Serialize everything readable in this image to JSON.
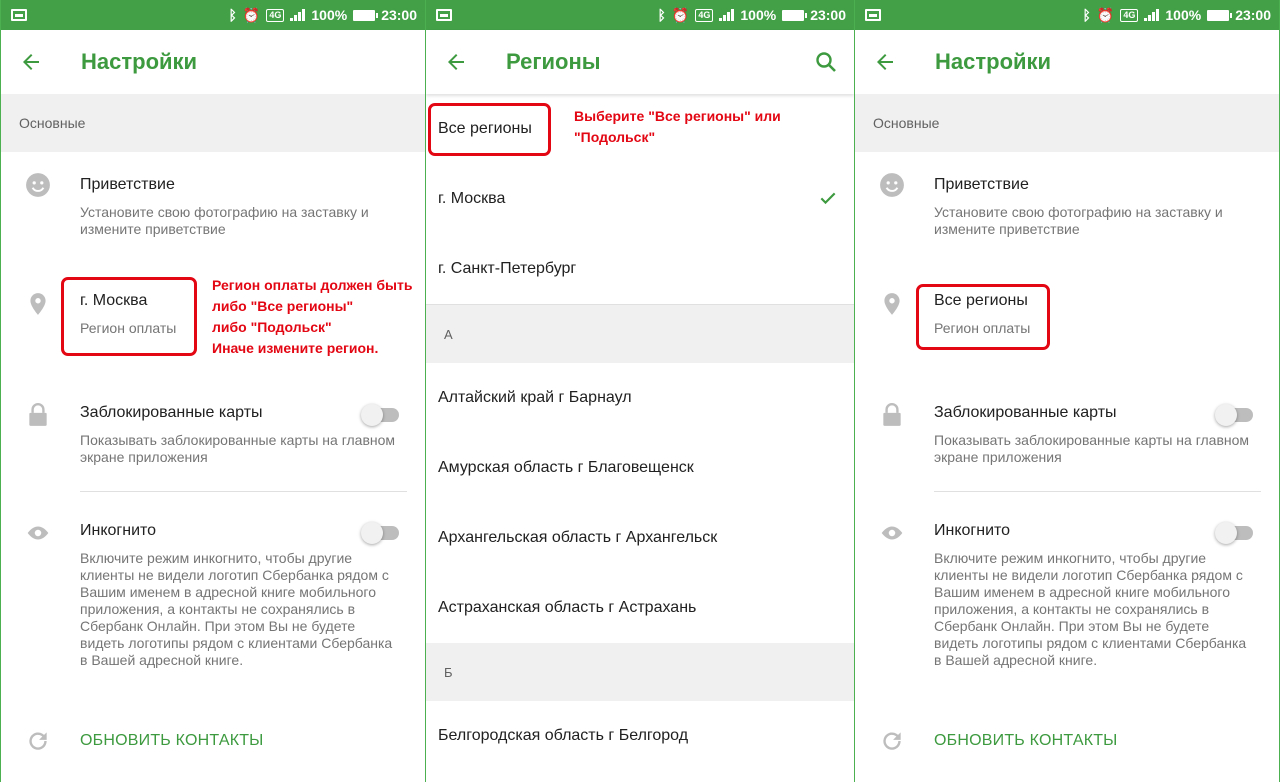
{
  "status_bar": {
    "battery": "100%",
    "time": "23:00",
    "network": "4G",
    "icons": [
      "screenshot-icon",
      "bluetooth-icon",
      "alarm-icon",
      "4g-icon",
      "signal-icon",
      "battery-icon"
    ]
  },
  "colors": {
    "status_bar": "#43a047",
    "accent": "#3d9a3f",
    "annotation": "#e30613",
    "section_bg": "#f0f0f0"
  },
  "screen1": {
    "title": "Настройки",
    "section": "Основные",
    "greeting": {
      "title": "Приветствие",
      "subtitle": "Установите свою фотографию на заставку и измените приветствие"
    },
    "region": {
      "title": "г. Москва",
      "subtitle": "Регион оплаты"
    },
    "blocked_cards": {
      "title": "Заблокированные карты",
      "subtitle": "Показывать заблокированные карты на главном экране приложения",
      "enabled": false
    },
    "incognito": {
      "title": "Инкогнито",
      "subtitle": "Включите режим инкогнито, чтобы другие клиенты не видели логотип Сбербанка рядом с Вашим именем в адресной книге мобильного приложения, а контакты не сохранялись в Сбербанк Онлайн. При этом Вы не будете видеть логотипы рядом с клиентами Сбербанка в Вашей адресной книге.",
      "enabled": false
    },
    "refresh_contacts": "ОБНОВИТЬ КОНТАКТЫ",
    "annotation": [
      "Регион оплаты должен быть",
      "либо \"Все регионы\"",
      "либо \"Подольск\"",
      "Иначе измените регион."
    ]
  },
  "screen2": {
    "title": "Регионы",
    "annotation": [
      "Выберите \"Все регионы\" или",
      "\"Подольск\""
    ],
    "top_items": [
      "Все регионы",
      "г. Москва",
      "г. Санкт-Петербург"
    ],
    "selected": "г. Москва",
    "letter_a": "А",
    "a_items": [
      "Алтайский край г Барнаул",
      "Амурская область г Благовещенск",
      "Архангельская область г Архангельск",
      "Астраханская область г Астрахань"
    ],
    "letter_b": "Б",
    "b_items": [
      "Белгородская область г Белгород"
    ]
  },
  "screen3": {
    "title": "Настройки",
    "section": "Основные",
    "greeting": {
      "title": "Приветствие",
      "subtitle": "Установите свою фотографию на заставку и измените приветствие"
    },
    "region": {
      "title": "Все регионы",
      "subtitle": "Регион оплаты"
    },
    "blocked_cards": {
      "title": "Заблокированные карты",
      "subtitle": "Показывать заблокированные карты на главном экране приложения",
      "enabled": false
    },
    "incognito": {
      "title": "Инкогнито",
      "subtitle": "Включите режим инкогнито, чтобы другие клиенты не видели логотип Сбербанка рядом с Вашим именем в адресной книге мобильного приложения, а контакты не сохранялись в Сбербанк Онлайн. При этом Вы не будете видеть логотипы рядом с клиентами Сбербанка в Вашей адресной книге.",
      "enabled": false
    },
    "refresh_contacts": "ОБНОВИТЬ КОНТАКТЫ"
  }
}
